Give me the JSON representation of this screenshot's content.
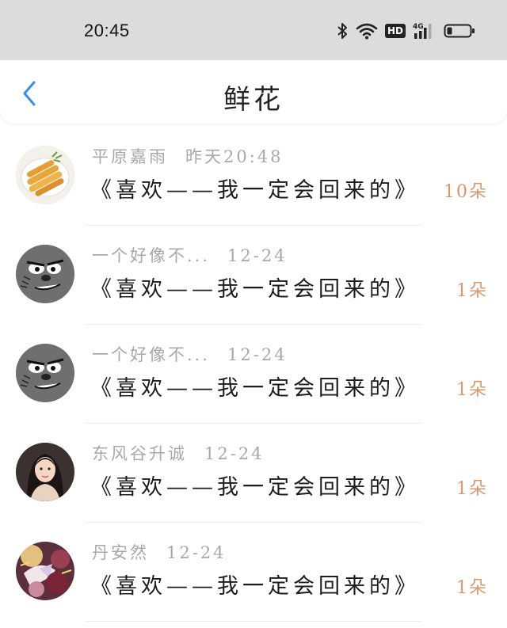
{
  "status_bar": {
    "time": "20:45",
    "hd_badge": "HD",
    "network_label": "4G",
    "icons": [
      "bluetooth-icon",
      "wifi-icon",
      "hd-icon",
      "cellular-signal-icon",
      "battery-icon"
    ]
  },
  "header": {
    "title": "鲜花",
    "back_icon": "chevron-left-icon",
    "accent_color": "#3a8ee6"
  },
  "list": {
    "count_color": "#d9976a",
    "items": [
      {
        "name": "平原嘉雨",
        "date": "昨天20:48",
        "message": "《喜欢——我一定会回来的》",
        "count": "10朵",
        "avatar": "food-avatar"
      },
      {
        "name": "一个好像不...",
        "date": "12-24",
        "message": "《喜欢——我一定会回来的》",
        "count": "1朵",
        "avatar": "cartoon-face-avatar"
      },
      {
        "name": "一个好像不...",
        "date": "12-24",
        "message": "《喜欢——我一定会回来的》",
        "count": "1朵",
        "avatar": "cartoon-face-avatar"
      },
      {
        "name": "东风谷升诚",
        "date": "12-24",
        "message": "《喜欢——我一定会回来的》",
        "count": "1朵",
        "avatar": "girl-photo-avatar"
      },
      {
        "name": "丹安然",
        "date": "12-24",
        "message": "《喜欢——我一定会回来的》",
        "count": "1朵",
        "avatar": "anime-art-avatar"
      }
    ]
  }
}
